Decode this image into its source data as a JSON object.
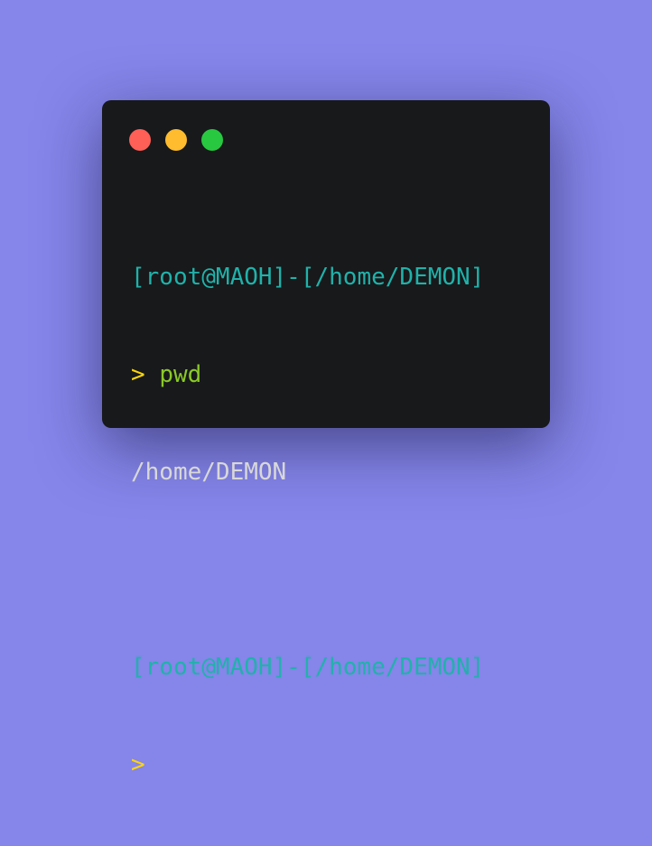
{
  "window": {
    "controls": [
      {
        "name": "close",
        "color": "#fe5f57"
      },
      {
        "name": "minimize",
        "color": "#febc2e"
      },
      {
        "name": "maximize",
        "color": "#28c840"
      }
    ]
  },
  "terminal": {
    "prompt_1": "[root@MAOH]-[/home/DEMON]",
    "caret_1": ">",
    "command_1": "pwd",
    "output_1": "/home/DEMON",
    "prompt_2": "[root@MAOH]-[/home/DEMON]",
    "caret_2": ">"
  },
  "colors": {
    "background": "#8585ea",
    "terminal_bg": "#17191b",
    "prompt": "#20b2aa",
    "caret": "#ffd60a",
    "command": "#8ac926",
    "output": "#d8d8d8"
  }
}
